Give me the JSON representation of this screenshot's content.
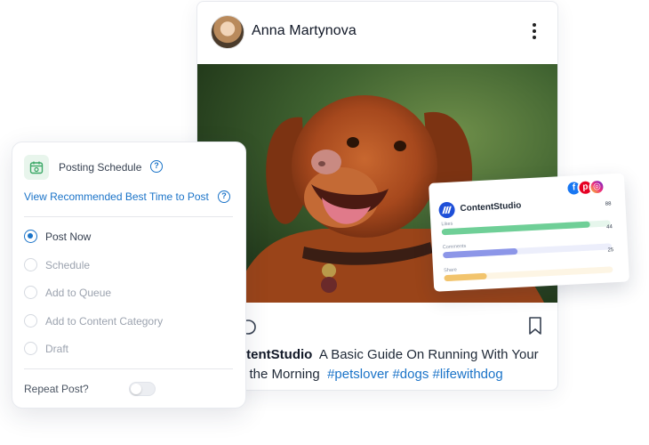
{
  "post": {
    "author": "Anna Martynova",
    "caption_brand": "ntentStudio",
    "caption_line1": "A Basic Guide On Running With Your",
    "caption_line2_start": "n the Morning",
    "hashtags": "#petslover #dogs #lifewithdog"
  },
  "analytics": {
    "brand": "ContentStudio",
    "socials": [
      "facebook-icon",
      "pinterest-icon",
      "instagram-icon"
    ],
    "stats": [
      {
        "label": "Likes",
        "value": "88",
        "fill": 0.88,
        "color": "#6fcf97",
        "track": "#e6f6ec"
      },
      {
        "label": "Comments",
        "value": "44",
        "fill": 0.44,
        "color": "#8c96e8",
        "track": "#eceefb"
      },
      {
        "label": "Share",
        "value": "25",
        "fill": 0.25,
        "color": "#f2c46d",
        "track": "#fdf5e4"
      }
    ]
  },
  "schedule": {
    "title": "Posting Schedule",
    "recommend_link": "View Recommended Best Time to Post",
    "options": [
      {
        "label": "Post Now",
        "selected": true
      },
      {
        "label": "Schedule",
        "selected": false
      },
      {
        "label": "Add to Queue",
        "selected": false
      },
      {
        "label": "Add to Content Category",
        "selected": false
      },
      {
        "label": "Draft",
        "selected": false
      }
    ],
    "repeat_label": "Repeat Post?",
    "repeat_enabled": false
  },
  "colors": {
    "accent": "#1a73c8",
    "hashtag": "#1a73c8",
    "brand_blue": "#1e4fd8"
  }
}
